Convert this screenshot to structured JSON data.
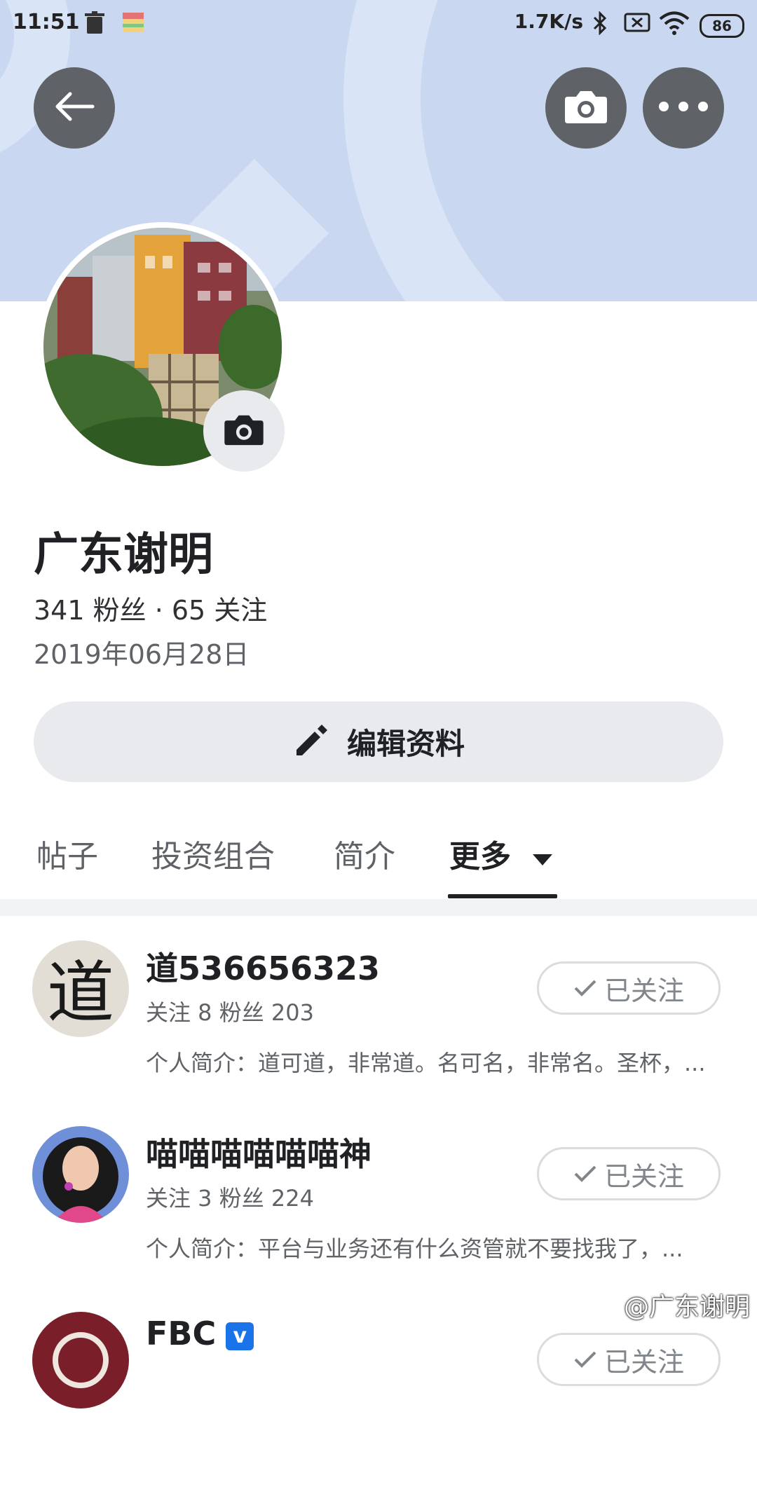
{
  "status_bar": {
    "time": "11:51",
    "network_speed": "1.7K/s",
    "battery": "86"
  },
  "header": {
    "back_icon": "arrow-left-icon",
    "camera_icon": "camera-icon",
    "more_icon": "more-horizontal-icon"
  },
  "profile": {
    "name": "广东谢明",
    "stats": "341 粉丝 · 65 关注",
    "joined": "2019年06月28日",
    "edit_label": "编辑资料"
  },
  "tabs": [
    {
      "label": "帖子"
    },
    {
      "label": "投资组合"
    },
    {
      "label": "简介"
    },
    {
      "label": "更多",
      "active": true
    }
  ],
  "following": [
    {
      "name": "道536656323",
      "counts": "关注 8 粉丝 203",
      "bio": "个人简介：道可道，非常道。名可名，非常名。圣杯，...",
      "button": "已关注"
    },
    {
      "name": "喵喵喵喵喵喵神",
      "counts": "关注 3 粉丝 224",
      "bio": "个人简介：平台与业务还有什么资管就不要找我了，...",
      "button": "已关注"
    },
    {
      "name": "FBC",
      "verified_mark": "v",
      "button": "已关注"
    }
  ],
  "watermark": "@广东谢明",
  "colors": {
    "banner": "#c9d8f0",
    "button_bg": "#5f6368",
    "accent_verified": "#1a73e8"
  }
}
